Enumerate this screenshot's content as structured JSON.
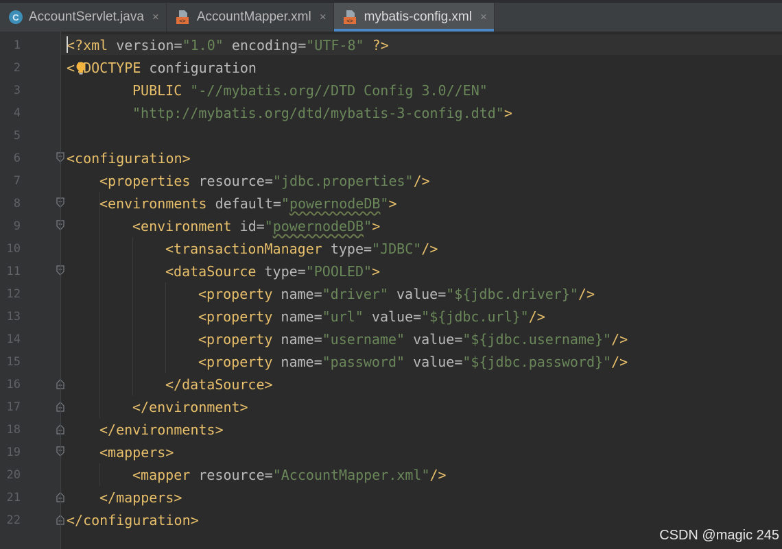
{
  "tabs": [
    {
      "label": "AccountServlet.java",
      "icon": "java-class-icon",
      "active": false
    },
    {
      "label": "AccountMapper.xml",
      "icon": "xml-file-icon",
      "active": false
    },
    {
      "label": "mybatis-config.xml",
      "icon": "xml-file-icon",
      "active": true
    }
  ],
  "close_glyph": "×",
  "line_numbers": [
    "1",
    "2",
    "3",
    "4",
    "5",
    "6",
    "7",
    "8",
    "9",
    "10",
    "11",
    "12",
    "13",
    "14",
    "15",
    "16",
    "17",
    "18",
    "19",
    "20",
    "21",
    "22"
  ],
  "code": {
    "l1": {
      "lt": "<",
      "decl": "?xml",
      "a1": " version",
      "eq1": "=",
      "v1": "\"1.0\"",
      "a2": " encoding",
      "eq2": "=",
      "v2": "\"UTF-8\"",
      "end": " ?>"
    },
    "l2": {
      "open": "<!DOCTYPE",
      "rest": " configuration"
    },
    "l3": {
      "kw": "PUBLIC",
      "val": "\"-//mybatis.org//DTD Config 3.0//EN\""
    },
    "l4": {
      "val": "\"http://mybatis.org/dtd/mybatis-3-config.dtd\"",
      "end": ">"
    },
    "l6": {
      "tag": "<configuration>"
    },
    "l7": {
      "tag": "<properties",
      "attr": " resource",
      "eq": "=",
      "val": "\"jdbc.properties\"",
      "end": "/>"
    },
    "l8": {
      "tag": "<environments",
      "attr": " default",
      "eq": "=",
      "val_q1": "\"",
      "val": "powernodeDB",
      "val_q2": "\"",
      "end": ">"
    },
    "l9": {
      "tag": "<environment",
      "attr": " id",
      "eq": "=",
      "val_q1": "\"",
      "val": "powernodeDB",
      "val_q2": "\"",
      "end": ">"
    },
    "l10": {
      "tag": "<transactionManager",
      "attr": " type",
      "eq": "=",
      "val": "\"JDBC\"",
      "end": "/>"
    },
    "l11": {
      "tag": "<dataSource",
      "attr": " type",
      "eq": "=",
      "val": "\"POOLED\"",
      "end": ">"
    },
    "l12": {
      "tag": "<property",
      "a1": " name",
      "eq1": "=",
      "v1": "\"driver\"",
      "a2": " value",
      "eq2": "=",
      "v2": "\"${jdbc.driver}\"",
      "end": "/>"
    },
    "l13": {
      "tag": "<property",
      "a1": " name",
      "eq1": "=",
      "v1": "\"url\"",
      "a2": " value",
      "eq2": "=",
      "v2": "\"${jdbc.url}\"",
      "end": "/>"
    },
    "l14": {
      "tag": "<property",
      "a1": " name",
      "eq1": "=",
      "v1": "\"username\"",
      "a2": " value",
      "eq2": "=",
      "v2": "\"${jdbc.username}\"",
      "end": "/>"
    },
    "l15": {
      "tag": "<property",
      "a1": " name",
      "eq1": "=",
      "v1": "\"password\"",
      "a2": " value",
      "eq2": "=",
      "v2": "\"${jdbc.password}\"",
      "end": "/>"
    },
    "l16": {
      "tag": "</dataSource>"
    },
    "l17": {
      "tag": "</environment>"
    },
    "l18": {
      "tag": "</environments>"
    },
    "l19": {
      "tag": "<mappers>"
    },
    "l20": {
      "tag": "<mapper",
      "attr": " resource",
      "eq": "=",
      "val": "\"AccountMapper.xml\"",
      "end": "/>"
    },
    "l21": {
      "tag": "</mappers>"
    },
    "l22": {
      "tag": "</configuration>"
    }
  },
  "watermark": "CSDN @magic 245",
  "colors": {
    "background": "#2b2b2b",
    "tag": "#e8bf6a",
    "string": "#6a8759",
    "attribute": "#bababa",
    "active_tab_underline": "#4a88c7"
  }
}
